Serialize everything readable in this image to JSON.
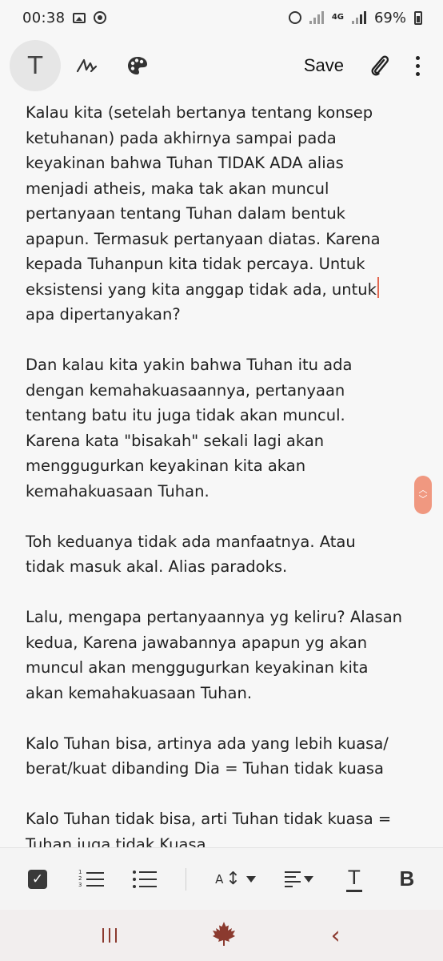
{
  "status_bar": {
    "time": "00:38",
    "network": "4G",
    "battery": "69%"
  },
  "toolbar": {
    "save_label": "Save",
    "text_mode_glyph": "T",
    "icons": [
      "text-mode-icon",
      "pen-icon",
      "palette-icon",
      "attachment-icon",
      "more-vert-icon"
    ]
  },
  "editor": {
    "paragraphs": [
      {
        "before_caret": "Kalau kita (setelah bertanya tentang konsep\nketuhanan) pada akhirnya sampai pada\nkeyakinan bahwa Tuhan TIDAK ADA alias\nmenjadi atheis, maka tak akan muncul\npertanyaan tentang Tuhan dalam bentuk\napapun. Termasuk pertanyaan diatas. Karena\nkepada Tuhanpun kita tidak percaya. Untuk\neksistensi yang kita anggap tidak ada, untuk",
        "after_caret": "\napa dipertanyakan?"
      },
      "Dan kalau kita yakin bahwa Tuhan itu ada\ndengan kemahakuasaannya, pertanyaan\ntentang batu itu juga tidak akan muncul.\nKarena kata \"bisakah\" sekali lagi akan\nmenggugurkan keyakinan kita akan\nkemahakuasaan Tuhan.",
      "Toh keduanya tidak ada manfaatnya. Atau\ntidak masuk akal. Alias paradoks.",
      "Lalu, mengapa pertanyaannya yg keliru? Alasan\nkedua, Karena jawabannya apapun yg akan\nmuncul akan menggugurkan keyakinan kita\nakan kemahakuasaan Tuhan.",
      "Kalo Tuhan bisa, artinya ada yang lebih kuasa/\nberat/kuat dibanding Dia = Tuhan tidak kuasa",
      "Kalo Tuhan tidak bisa, arti Tuhan tidak kuasa =\nTuhan juga tidak Kuasa."
    ]
  },
  "format_bar": {
    "bold_glyph": "B",
    "text_color_glyph": "T",
    "size_glyph_small": "A",
    "size_glyph_arrow": "↕",
    "check_glyph": "✓",
    "numbered_list_marks": [
      "1",
      "2",
      "3"
    ]
  },
  "nav_bar": {
    "back_glyph": "‹"
  },
  "colors": {
    "caret": "#e2674f",
    "scroll_handle": "#f09880",
    "nav_accent": "#8b3a2f"
  }
}
